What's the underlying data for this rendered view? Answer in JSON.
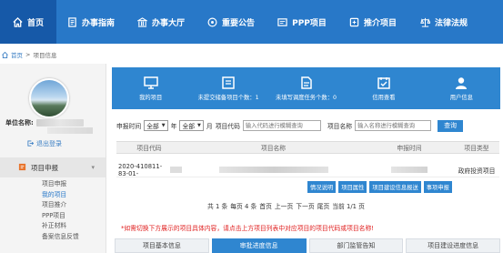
{
  "nav": {
    "items": [
      {
        "label": "首页",
        "icon": "home-icon",
        "active": true
      },
      {
        "label": "办事指南",
        "icon": "guide-icon"
      },
      {
        "label": "办事大厅",
        "icon": "hall-icon"
      },
      {
        "label": "重要公告",
        "icon": "announcement-icon"
      },
      {
        "label": "PPP项目",
        "icon": "ppp-icon"
      },
      {
        "label": "推介项目",
        "icon": "promote-icon"
      },
      {
        "label": "法律法规",
        "icon": "law-icon"
      }
    ]
  },
  "breadcrumb": {
    "home": "首页",
    "separator": ">",
    "current": "项目信息"
  },
  "sidebar": {
    "unit_label": "单位名称:",
    "logout": "退出登录",
    "menu_head": "项目申报",
    "items": [
      "项目申报",
      "我的项目",
      "项目推介",
      "PPP项目",
      "补正材料",
      "备案信息反馈"
    ]
  },
  "banner": {
    "items": [
      {
        "label": "我的项目",
        "icon": "monitor-icon"
      },
      {
        "label": "未提交储备项目个数：1",
        "icon": "archive-icon"
      },
      {
        "label": "未填写调度任务个数：0",
        "icon": "document-icon"
      },
      {
        "label": "信用查看",
        "icon": "credit-icon"
      },
      {
        "label": "用户信息",
        "icon": "user-icon"
      }
    ]
  },
  "filter": {
    "time_label": "申报时间",
    "year_value": "全部",
    "year_unit": "年",
    "month_value": "全部",
    "month_unit": "月",
    "code_label": "项目代码",
    "code_placeholder": "输入代码进行模糊查询",
    "name_label": "项目名称",
    "name_placeholder": "输入名称进行模糊查询",
    "search_button": "查询"
  },
  "table": {
    "columns": [
      "项目代码",
      "项目名称",
      "申报时间",
      "项目类型"
    ],
    "rows": [
      {
        "code": "2020-410811-83-01-",
        "type": "政府投资项目"
      }
    ],
    "actions": [
      "情况说明",
      "项目属性",
      "项目建设信息报送",
      "事项申报"
    ]
  },
  "pager": {
    "total": "共 1 条",
    "per_page": "每页 4 条",
    "first": "首页",
    "prev": "上一页",
    "next": "下一页",
    "last": "尾页",
    "current": "当前 1/1 页"
  },
  "notice": "*如需切换下方展示的项目具体内容，请点击上方项目列表中对应项目的项目代码或项目名称!",
  "tabs": [
    {
      "label": "项目基本信息"
    },
    {
      "label": "审批进度信息",
      "active": true
    },
    {
      "label": "部门监管告知"
    },
    {
      "label": "项目建设进度信息"
    }
  ],
  "colors": {
    "nav_bg": "#2878c8",
    "nav_active": "#1659a8",
    "accent": "#2f86d0",
    "notice": "#e02020"
  }
}
